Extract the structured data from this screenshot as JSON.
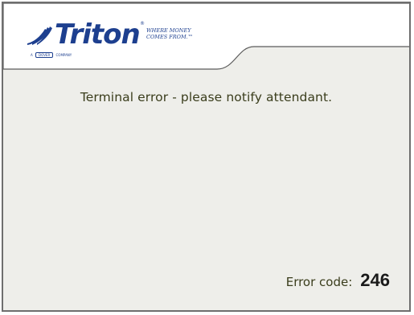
{
  "brand": {
    "name": "Triton",
    "registered_mark": "®",
    "tagline": "Where money comes from.™",
    "parent_prefix": "A",
    "parent_name": "DOVER",
    "parent_suffix": "COMPANY"
  },
  "message": "Terminal error - please notify attendant.",
  "error": {
    "label": "Error code:",
    "code": "246"
  },
  "colors": {
    "background": "#eeeeea",
    "header_white": "#ffffff",
    "brand_blue": "#1d3f8f",
    "message_text": "#3a3d1c",
    "frame_border": "#6e6e6e"
  },
  "icons": {
    "logo_mark": "triton-swoosh-icon"
  }
}
